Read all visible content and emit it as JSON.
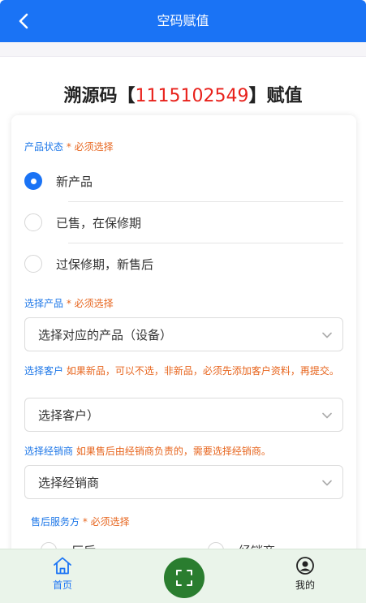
{
  "header": {
    "title": "空码赋值"
  },
  "heading": {
    "prefix": "溯源码【",
    "code": "1115102549",
    "suffix": "】赋值"
  },
  "product_status": {
    "label": "产品状态",
    "required": "* 必须选择",
    "options": [
      {
        "text": "新产品",
        "checked": true
      },
      {
        "text": "已售，在保修期",
        "checked": false
      },
      {
        "text": "过保修期，新售后",
        "checked": false
      }
    ]
  },
  "product": {
    "label": "选择产品",
    "required": "* 必须选择",
    "value": "选择对应的产品（设备）"
  },
  "customer": {
    "label": "选择客户",
    "hint": "如果新品，可以不选，非新品，必须先添加客户资料，再提交。",
    "value": "选择客户）"
  },
  "dealer": {
    "label": "选择经销商",
    "hint": "如果售后由经销商负责的，需要选择经销商。",
    "value": "选择经销商"
  },
  "service": {
    "label": "售后服务方",
    "required": "* 必须选择",
    "options": [
      {
        "text": "厂后"
      },
      {
        "text": "经销商"
      }
    ]
  },
  "tabbar": {
    "home": "首页",
    "mine": "我的"
  },
  "colors": {
    "primary": "#1a73f5",
    "warn": "#e7661f",
    "code": "#e8211b",
    "scan": "#2a7d2f"
  }
}
